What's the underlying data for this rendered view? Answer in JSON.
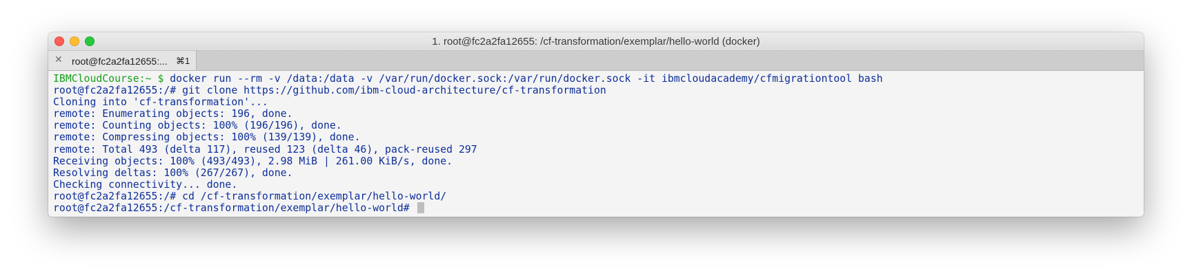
{
  "window": {
    "title": "1. root@fc2a2fa12655: /cf-transformation/exemplar/hello-world (docker)"
  },
  "tab": {
    "label": "root@fc2a2fa12655:...",
    "shortcut": "⌘1"
  },
  "terminal": {
    "first_prompt": "IBMCloudCourse:~ $",
    "first_command": " docker run --rm -v /data:/data -v /var/run/docker.sock:/var/run/docker.sock -it ibmcloudacademy/cfmigrationtool bash",
    "lines": [
      "root@fc2a2fa12655:/# git clone https://github.com/ibm-cloud-architecture/cf-transformation",
      "Cloning into 'cf-transformation'...",
      "remote: Enumerating objects: 196, done.",
      "remote: Counting objects: 100% (196/196), done.",
      "remote: Compressing objects: 100% (139/139), done.",
      "remote: Total 493 (delta 117), reused 123 (delta 46), pack-reused 297",
      "Receiving objects: 100% (493/493), 2.98 MiB | 261.00 KiB/s, done.",
      "Resolving deltas: 100% (267/267), done.",
      "Checking connectivity... done.",
      "root@fc2a2fa12655:/# cd /cf-transformation/exemplar/hello-world/",
      "root@fc2a2fa12655:/cf-transformation/exemplar/hello-world# "
    ]
  },
  "colors": {
    "text": "#0d2e99",
    "prompt": "#16a01a",
    "background": "#f4f4f4"
  }
}
